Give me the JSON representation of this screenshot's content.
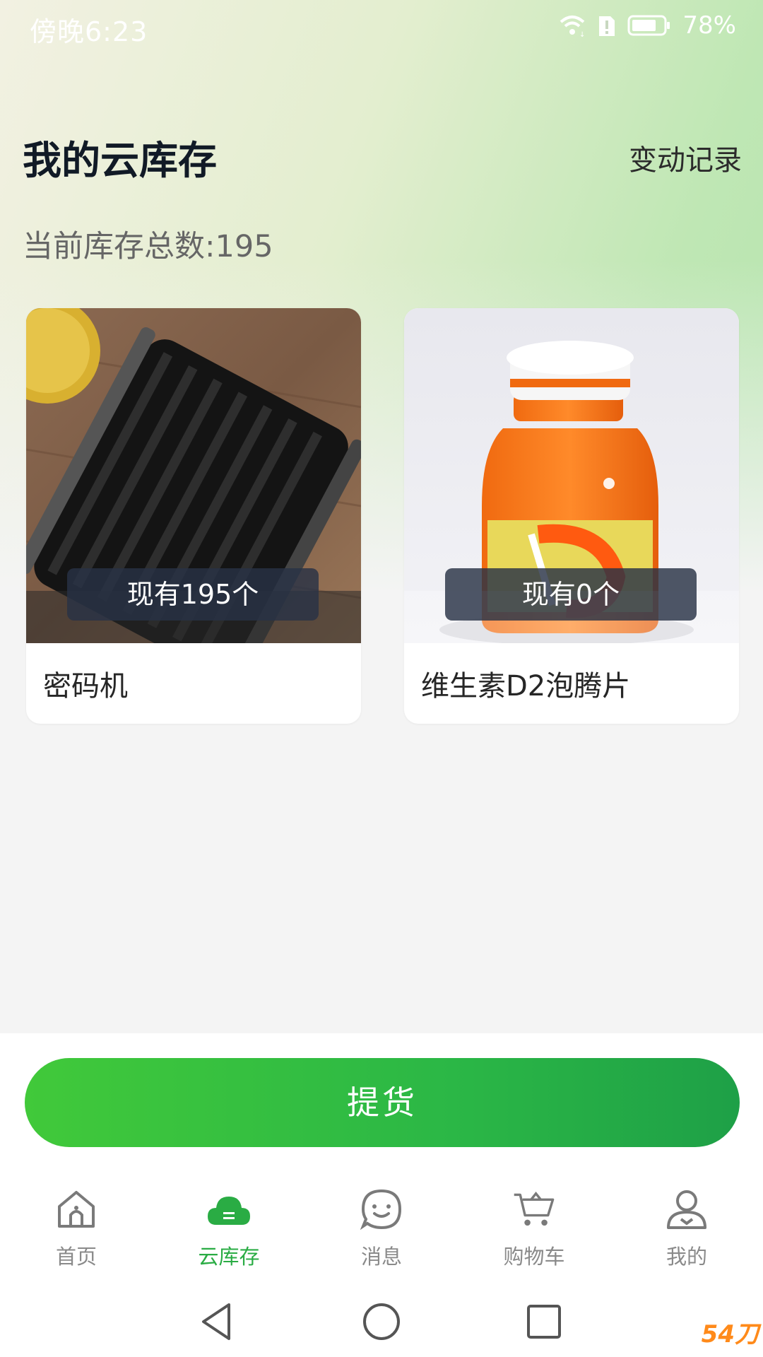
{
  "status_bar": {
    "time": "傍晚6:23",
    "battery_percent": "78%",
    "battery_level": 0.78
  },
  "header": {
    "title": "我的云库存",
    "history_link": "变动记录"
  },
  "summary": {
    "total_label": "当前库存总数:195"
  },
  "products": [
    {
      "name": "密码机",
      "stock_label": "现有195个"
    },
    {
      "name": "维生素D2泡腾片",
      "stock_label": "现有0个"
    }
  ],
  "pickup_button": {
    "label": "提货"
  },
  "tabs": [
    {
      "label": "首页",
      "icon": "home-icon"
    },
    {
      "label": "云库存",
      "icon": "cloud-storage-icon"
    },
    {
      "label": "消息",
      "icon": "message-icon"
    },
    {
      "label": "购物车",
      "icon": "cart-icon"
    },
    {
      "label": "我的",
      "icon": "profile-icon"
    }
  ],
  "system_nav": {
    "back": "back-icon",
    "home": "home-circle-icon",
    "recents": "recents-icon"
  },
  "watermark": "54刀"
}
